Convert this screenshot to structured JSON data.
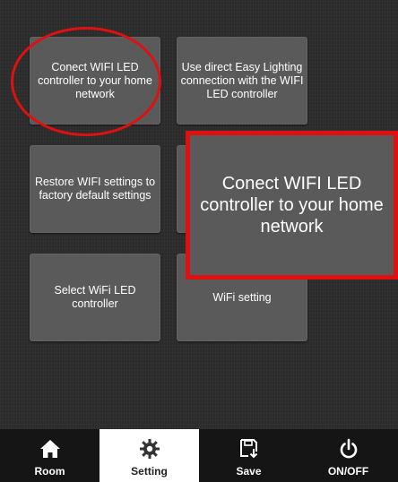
{
  "tiles": [
    {
      "label": "Conect WIFI LED controller to your home network"
    },
    {
      "label": "Use direct Easy Lighting connection with the WIFI LED controller"
    },
    {
      "label": "Restore WIFI settings to factory default settings"
    },
    {
      "label": ""
    },
    {
      "label": "Select WiFi LED controller"
    },
    {
      "label": "WiFi setting"
    }
  ],
  "callout": {
    "label": "Conect WIFI LED controller to your home network"
  },
  "tabbar": {
    "items": [
      {
        "label": "Room",
        "icon": "home-icon"
      },
      {
        "label": "Setting",
        "icon": "gear-icon"
      },
      {
        "label": "Save",
        "icon": "save-disk-icon"
      },
      {
        "label": "ON/OFF",
        "icon": "power-icon"
      }
    ],
    "active": "Setting"
  },
  "colors": {
    "highlight": "#e01010",
    "tile": "#5a5a5a",
    "background": "#2b2b2b"
  }
}
